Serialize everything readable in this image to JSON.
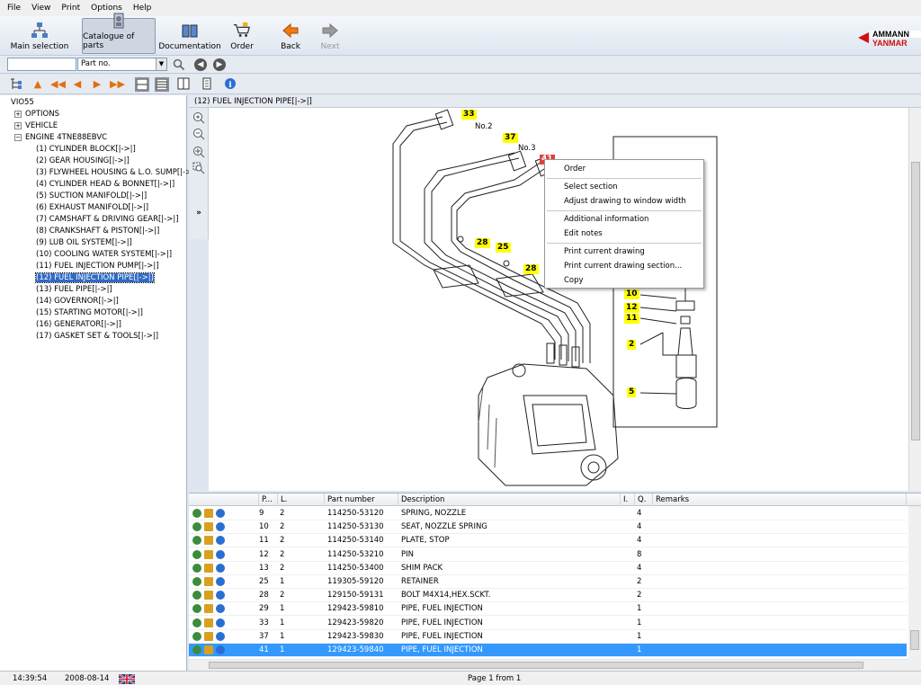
{
  "menu": [
    "File",
    "View",
    "Print",
    "Options",
    "Help"
  ],
  "toolbar": {
    "main_selection": "Main selection",
    "catalogue": "Catalogue of parts",
    "documentation": "Documentation",
    "order": "Order",
    "back": "Back",
    "next": "Next"
  },
  "search": {
    "value": "",
    "field": "Part no."
  },
  "tree": {
    "root": "VIO55",
    "items": [
      "OPTIONS",
      "VEHICLE",
      "ENGINE 4TNE88EBVC"
    ],
    "children": [
      "(1) CYLINDER BLOCK[|->|]",
      "(2) GEAR HOUSING[|->|]",
      "(3) FLYWHEEL HOUSING & L.O. SUMP[|->|]",
      "(4) CYLINDER HEAD & BONNET[|->|]",
      "(5) SUCTION MANIFOLD[|->|]",
      "(6) EXHAUST MANIFOLD[|->|]",
      "(7) CAMSHAFT & DRIVING GEAR[|->|]",
      "(8) CRANKSHAFT & PISTON[|->|]",
      "(9) LUB OIL SYSTEM[|->|]",
      "(10) COOLING WATER SYSTEM[|->|]",
      "(11) FUEL INJECTION PUMP[|->|]",
      "(12) FUEL INJECTION PIPE[|->|]",
      "(13) FUEL PIPE[|->|]",
      "(14) GOVERNOR[|->|]",
      "(15) STARTING MOTOR[|->|]",
      "(16) GENERATOR[|->|]",
      "(17) GASKET SET & TOOLS[|->|]"
    ]
  },
  "drawing": {
    "title": "(12) FUEL INJECTION PIPE[|->|]",
    "callouts": {
      "c33": "33",
      "c37": "37",
      "c41": "41",
      "c28a": "28",
      "c25": "25",
      "c28b": "28",
      "c10": "10",
      "c12": "12",
      "c11": "11",
      "c2": "2",
      "c5": "5"
    },
    "no2": "No.2",
    "no3": "No.3"
  },
  "context_menu": {
    "order": "Order",
    "select_section": "Select section",
    "adjust": "Adjust drawing to window width",
    "additional": "Additional information",
    "edit_notes": "Edit notes",
    "print_current": "Print current drawing",
    "print_section": "Print current drawing section...",
    "copy": "Copy"
  },
  "table": {
    "headers": [
      "P...",
      "L.",
      "Part number",
      "Description",
      "I.",
      "Q.",
      "Remarks"
    ],
    "rows": [
      {
        "pos": "9",
        "lvl": "2",
        "part": "114250-53120",
        "desc": "SPRING, NOZZLE",
        "qty": "4"
      },
      {
        "pos": "10",
        "lvl": "2",
        "part": "114250-53130",
        "desc": "SEAT, NOZZLE SPRING",
        "qty": "4"
      },
      {
        "pos": "11",
        "lvl": "2",
        "part": "114250-53140",
        "desc": "PLATE, STOP",
        "qty": "4"
      },
      {
        "pos": "12",
        "lvl": "2",
        "part": "114250-53210",
        "desc": "PIN",
        "qty": "8"
      },
      {
        "pos": "13",
        "lvl": "2",
        "part": "114250-53400",
        "desc": "SHIM PACK",
        "qty": "4"
      },
      {
        "pos": "25",
        "lvl": "1",
        "part": "119305-59120",
        "desc": "RETAINER",
        "qty": "2"
      },
      {
        "pos": "28",
        "lvl": "2",
        "part": "129150-59131",
        "desc": "BOLT M4X14,HEX.SCKT.",
        "qty": "2"
      },
      {
        "pos": "29",
        "lvl": "1",
        "part": "129423-59810",
        "desc": "PIPE, FUEL INJECTION",
        "qty": "1"
      },
      {
        "pos": "33",
        "lvl": "1",
        "part": "129423-59820",
        "desc": "PIPE, FUEL INJECTION",
        "qty": "1"
      },
      {
        "pos": "37",
        "lvl": "1",
        "part": "129423-59830",
        "desc": "PIPE, FUEL INJECTION",
        "qty": "1"
      },
      {
        "pos": "41",
        "lvl": "1",
        "part": "129423-59840",
        "desc": "PIPE, FUEL INJECTION",
        "qty": "1"
      }
    ]
  },
  "status": {
    "time": "14:39:54",
    "date": "2008-08-14",
    "page": "Page 1 from 1"
  },
  "colors": {
    "selection": "#316ac5",
    "row_selection": "#3399ff",
    "callout": "#ffff00"
  }
}
